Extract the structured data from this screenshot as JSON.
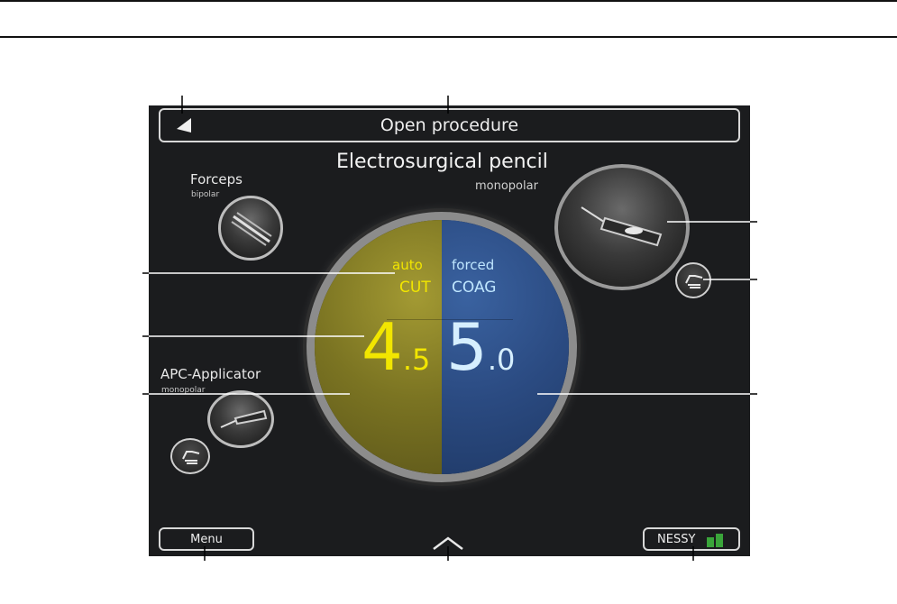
{
  "header": {
    "title": "Open procedure",
    "back_icon": "back-arrow-icon"
  },
  "instrument": {
    "name": "Electrosurgical pencil",
    "mode": "monopolar"
  },
  "forceps": {
    "name": "Forceps",
    "mode": "bipolar"
  },
  "apc": {
    "name": "APC-Applicator",
    "mode": "monopolar"
  },
  "cut": {
    "mode": "auto",
    "label": "CUT",
    "value_int": "4",
    "value_dec": ".5"
  },
  "coag": {
    "mode": "forced",
    "label": "COAG",
    "value_int": "5",
    "value_dec": ".0"
  },
  "footer": {
    "menu_label": "Menu",
    "nessy_label": "NESSY",
    "expand_icon": "chevron-up-icon"
  },
  "colors": {
    "cut_accent": "#f2e600",
    "coag_accent": "#bfe6ff",
    "cut_bg": "#8a8324",
    "coag_bg": "#2d4f86",
    "screen_bg": "#1b1c1e",
    "nessy_ok": "#3aa53a"
  }
}
